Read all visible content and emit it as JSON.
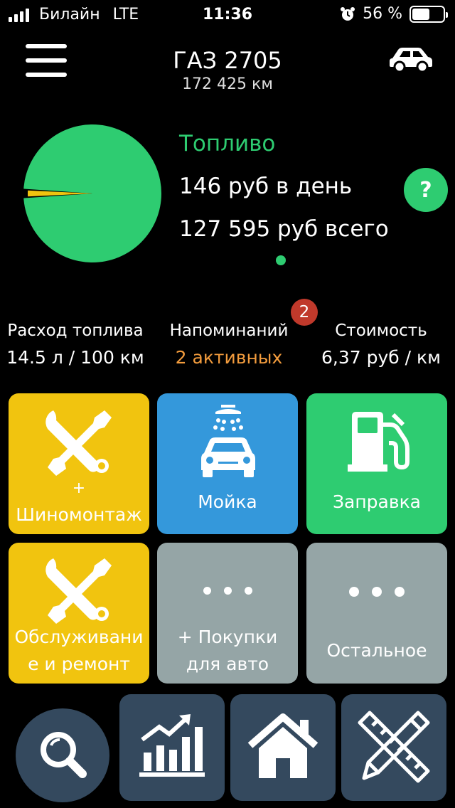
{
  "status_bar": {
    "carrier": "Билайн",
    "network": "LTE",
    "time": "11:36",
    "battery_text": "56 %",
    "battery_level": 0.56
  },
  "header": {
    "car_name": "ГАЗ 2705",
    "odometer": "172 425 км",
    "menu_icon": "hamburger-icon",
    "car_icon": "car-icon"
  },
  "fuel": {
    "title": "Топливо",
    "per_day": "146 руб в день",
    "total": "127 595 руб всего",
    "help_label": "?",
    "pie_fuel_share": 0.985,
    "pie_other_share": 0.015,
    "colors": {
      "fuel": "#2ecc71",
      "other": "#f1c40f"
    }
  },
  "stats": {
    "consumption_label": "Расход топлива",
    "consumption_value": "14.5 л / 100 км",
    "reminders_label": "Напоминаний",
    "reminders_value": "2 активных",
    "reminders_badge": "2",
    "cost_label": "Стоимость",
    "cost_value": "6,37 руб / км"
  },
  "tiles": {
    "tire_plus": "+",
    "tire_label": "Шиномонтаж",
    "wash_label": "Мойка",
    "fuel_label": "Заправка",
    "service_line1": "Обслуживани",
    "service_line2": "е и ремонт",
    "purchases_line1": "+ Покупки",
    "purchases_line2": "для авто",
    "other_label": "Остальное"
  },
  "nav": {
    "search_icon": "search-icon",
    "stats_icon": "chart-icon",
    "home_icon": "home-icon",
    "tools_icon": "ruler-pencil-icon"
  },
  "colors": {
    "green": "#2ecc71",
    "yellow": "#f1c40f",
    "blue": "#3498db",
    "gray": "#95a5a6",
    "orange": "#f39c3d",
    "badge_red": "#c0392b",
    "nav_dark": "#34495e"
  }
}
